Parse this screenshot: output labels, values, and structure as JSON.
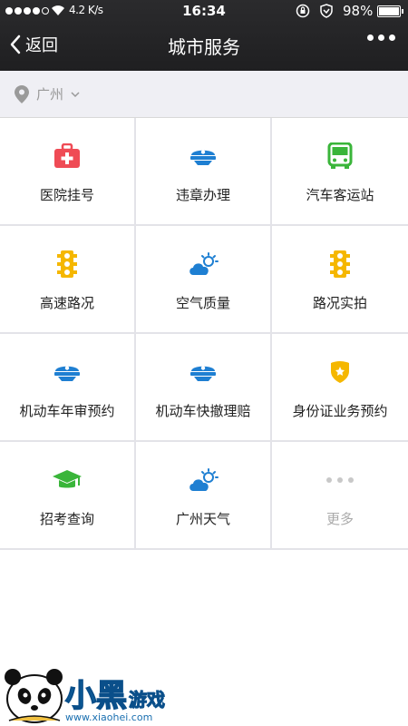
{
  "status_bar": {
    "signal_dots_filled": 4,
    "signal_dots_total": 5,
    "network_speed": "4.2 K/s",
    "time": "16:34",
    "battery_percent": "98%"
  },
  "nav": {
    "back_label": "返回",
    "title": "城市服务"
  },
  "location": {
    "city": "广州"
  },
  "services": [
    {
      "label": "医院挂号",
      "icon": "first-aid-kit-icon",
      "color": "#ef4b55"
    },
    {
      "label": "违章办理",
      "icon": "police-cap-icon",
      "color": "#1e7fd2"
    },
    {
      "label": "汽车客运站",
      "icon": "bus-icon",
      "color": "#3ab53a"
    },
    {
      "label": "高速路况",
      "icon": "traffic-light-icon",
      "color": "#f5b700"
    },
    {
      "label": "空气质量",
      "icon": "weather-cloud-sun-icon",
      "color": "#1e7fd2"
    },
    {
      "label": "路况实拍",
      "icon": "traffic-light-icon",
      "color": "#f5b700"
    },
    {
      "label": "机动车年审预约",
      "icon": "police-cap-icon",
      "color": "#1e7fd2"
    },
    {
      "label": "机动车快撤理赔",
      "icon": "police-cap-icon",
      "color": "#1e7fd2"
    },
    {
      "label": "身份证业务预约",
      "icon": "police-badge-icon",
      "color": "#f5b700"
    },
    {
      "label": "招考查询",
      "icon": "graduation-cap-icon",
      "color": "#3ab53a"
    },
    {
      "label": "广州天气",
      "icon": "weather-cloud-sun-icon",
      "color": "#1e7fd2"
    },
    {
      "label": "更多",
      "icon": "more-dots-icon",
      "color": "#c8c8c8"
    }
  ],
  "watermark": {
    "brand": "小黑游戏",
    "url": "www.xiaohei.com"
  }
}
